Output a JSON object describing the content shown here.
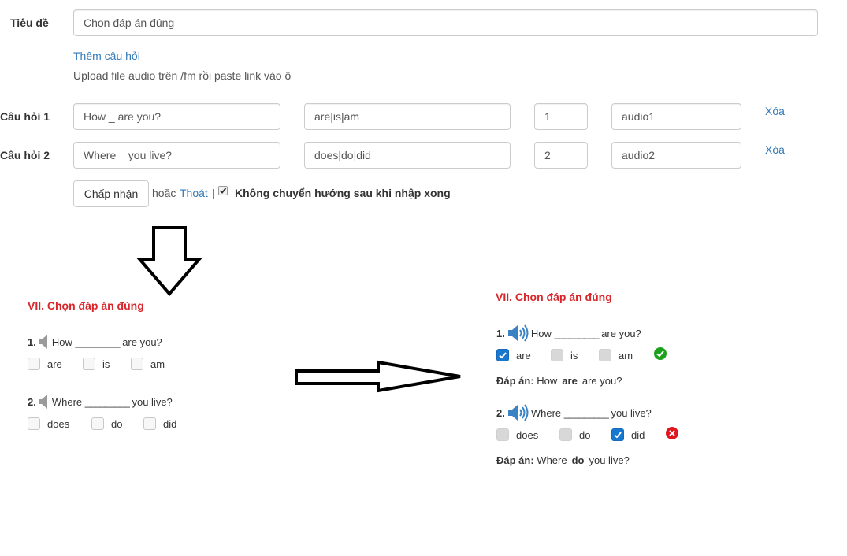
{
  "form": {
    "title_label": "Tiêu đề",
    "title_value": "Chọn đáp án đúng",
    "add_question_link": "Thêm câu hỏi",
    "upload_hint": "Upload file audio trên /fm rồi paste link vào ô",
    "questions": [
      {
        "label": "Câu hỏi 1",
        "text": "How _ are you?",
        "options": "are|is|am",
        "answer": "1",
        "audio": "audio1",
        "delete": "Xóa"
      },
      {
        "label": "Câu hỏi 2",
        "text": "Where _ you live?",
        "options": "does|do|did",
        "answer": "2",
        "audio": "audio2",
        "delete": "Xóa"
      }
    ],
    "accept_button": "Chấp nhận",
    "or_text": "hoặc",
    "exit_link": "Thoát",
    "separator": "|",
    "no_redirect_label": "Không chuyển hướng sau khi nhập xong",
    "no_redirect_checked": true
  },
  "preview_left": {
    "title": "VII. Chọn đáp án đúng",
    "questions": [
      {
        "number": "1.",
        "before": "How",
        "blank": "_________",
        "after": "are you?",
        "options": [
          "are",
          "is",
          "am"
        ],
        "icon": "speaker-muted-icon"
      },
      {
        "number": "2.",
        "before": "Where",
        "blank": "_________",
        "after": "you live?",
        "options": [
          "does",
          "do",
          "did"
        ],
        "icon": "speaker-muted-icon"
      }
    ]
  },
  "preview_right": {
    "title": "VII. Chọn đáp án đúng",
    "answer_label": "Đáp án:",
    "questions": [
      {
        "number": "1.",
        "before": "How",
        "blank": "_________",
        "after": "are you?",
        "options": [
          "are",
          "is",
          "am"
        ],
        "selected": "are",
        "result": "correct",
        "answer_before": "How",
        "answer_word": "are",
        "answer_after": "are you?",
        "icon": "speaker-volume-icon"
      },
      {
        "number": "2.",
        "before": "Where",
        "blank": "_________",
        "after": "you live?",
        "options": [
          "does",
          "do",
          "did"
        ],
        "selected": "did",
        "result": "wrong",
        "answer_before": "Where",
        "answer_word": "do",
        "answer_after": "you live?",
        "icon": "speaker-volume-icon"
      }
    ]
  },
  "colors": {
    "title_red": "#d9262b",
    "link_blue": "#337ab7",
    "checkbox_blue": "#1878d0",
    "correct_green": "#1ca11c",
    "wrong_red": "#e0151d",
    "speaker_blue": "#3a82c4"
  }
}
